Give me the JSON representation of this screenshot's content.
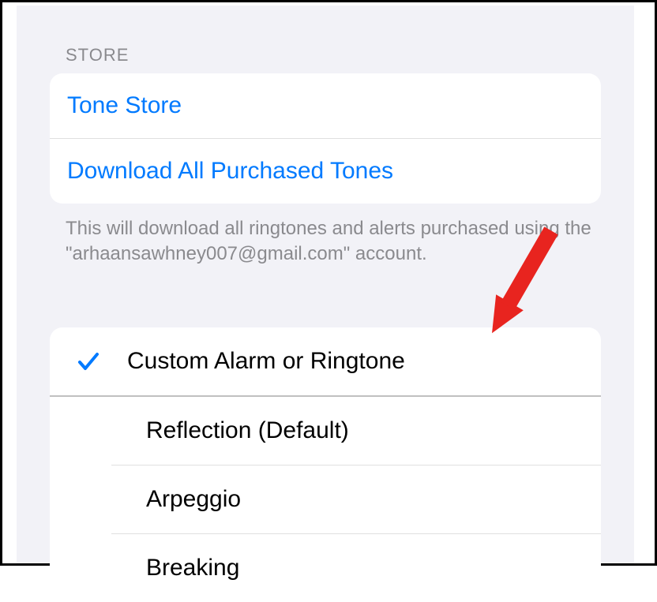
{
  "store": {
    "section_header": "STORE",
    "tone_store_label": "Tone Store",
    "download_all_label": "Download All Purchased Tones",
    "footer_text": "This will download all ringtones and alerts purchased using the \"arhaansawhney007@gmail.com\" account."
  },
  "ringtones": {
    "selected": {
      "label": "Custom Alarm or Ringtone"
    },
    "items": [
      {
        "label": "Reflection (Default)"
      },
      {
        "label": "Arpeggio"
      },
      {
        "label": "Breaking"
      }
    ]
  },
  "colors": {
    "link": "#007aff",
    "background": "#f2f2f7",
    "arrow": "#e8241f"
  }
}
